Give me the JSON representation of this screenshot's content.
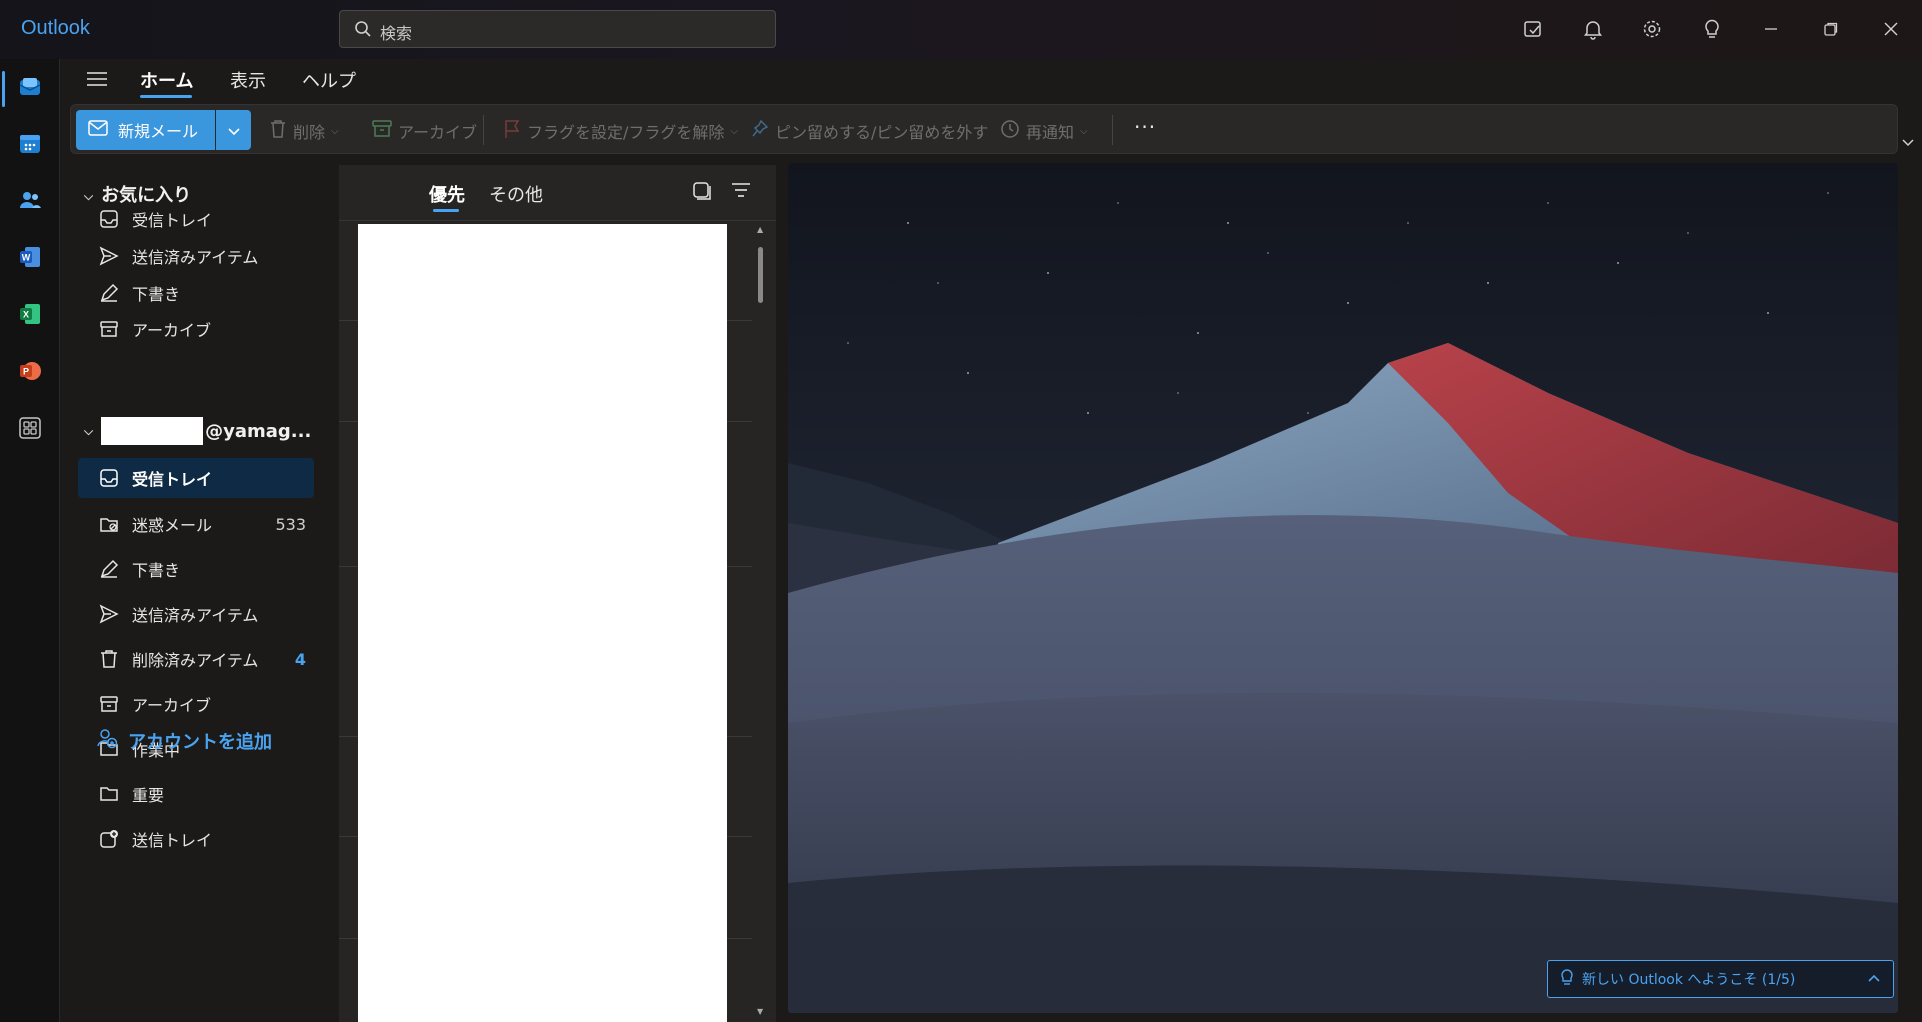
{
  "titlebar": {
    "app_name": "Outlook",
    "search_placeholder": "検索"
  },
  "ribbon_tabs": [
    "ホーム",
    "表示",
    "ヘルプ"
  ],
  "ribbon": {
    "new_mail": "新規メール",
    "delete": "削除",
    "archive": "アーカイブ",
    "flag": "フラグを設定/フラグを解除",
    "pin": "ピン留めする/ピン留めを外す",
    "snooze": "再通知",
    "more": "···"
  },
  "favorites": {
    "heading": "お気に入り",
    "items": [
      {
        "label": "受信トレイ",
        "icon": "inbox-icon"
      },
      {
        "label": "送信済みアイテム",
        "icon": "send-icon"
      },
      {
        "label": "下書き",
        "icon": "draft-pencil-icon"
      },
      {
        "label": "アーカイブ",
        "icon": "archive-icon"
      }
    ]
  },
  "account": {
    "email_suffix": "@yamag...",
    "folders": [
      {
        "label": "受信トレイ",
        "icon": "inbox-icon",
        "count": "",
        "selected": true
      },
      {
        "label": "迷惑メール",
        "icon": "junk-icon",
        "count": "533"
      },
      {
        "label": "下書き",
        "icon": "draft-pencil-icon",
        "count": ""
      },
      {
        "label": "送信済みアイテム",
        "icon": "send-icon",
        "count": ""
      },
      {
        "label": "削除済みアイテム",
        "icon": "trash-icon",
        "count": "4"
      },
      {
        "label": "アーカイブ",
        "icon": "archive-icon",
        "count": ""
      },
      {
        "label": "作業中",
        "icon": "folder-icon",
        "count": ""
      },
      {
        "label": "重要",
        "icon": "folder-icon",
        "count": ""
      },
      {
        "label": "送信トレイ",
        "icon": "outbox-icon",
        "count": ""
      }
    ]
  },
  "add_account": "アカウントを追加",
  "message_list": {
    "tabs": [
      "優先",
      "その他"
    ]
  },
  "welcome_banner": "新しい Outlook へようこそ (1/5)",
  "colors": {
    "accent": "#4aa3f0",
    "new_mail_button": "#3a96dd",
    "selected_folder": "#0f2a44"
  }
}
